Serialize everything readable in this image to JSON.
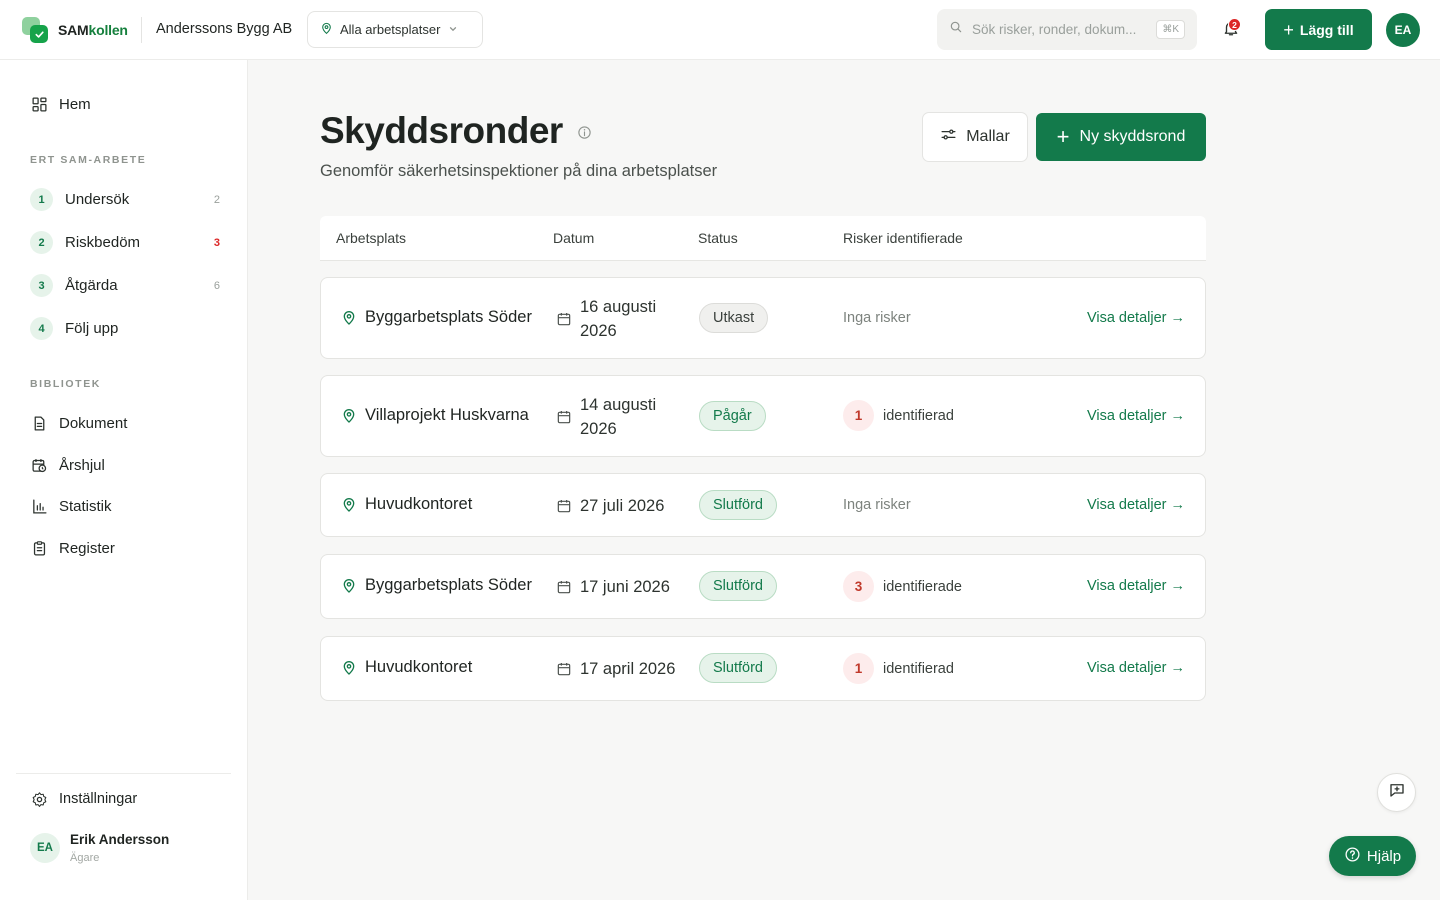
{
  "app": {
    "name_part1": "SAM",
    "name_part2": "kollen"
  },
  "header": {
    "company": "Anderssons Bygg AB",
    "workplace_selector": "Alla arbetsplatser",
    "search_placeholder": "Sök risker, ronder, dokum...",
    "search_shortcut": "⌘K",
    "notification_count": "2",
    "add_button": "Lägg till",
    "avatar_initials": "EA"
  },
  "sidebar": {
    "home": "Hem",
    "section_sam": "ERT SAM-ARBETE",
    "steps": [
      {
        "num": "1",
        "label": "Undersök",
        "count": "2"
      },
      {
        "num": "2",
        "label": "Riskbedöm",
        "count": "3"
      },
      {
        "num": "3",
        "label": "Åtgärda",
        "count": "6"
      },
      {
        "num": "4",
        "label": "Följ upp",
        "count": ""
      }
    ],
    "section_library": "BIBLIOTEK",
    "library": [
      {
        "label": "Dokument"
      },
      {
        "label": "Årshjul"
      },
      {
        "label": "Statistik"
      },
      {
        "label": "Register"
      }
    ],
    "settings": "Inställningar",
    "user": {
      "initials": "EA",
      "name": "Erik Andersson",
      "role": "Ägare"
    }
  },
  "main": {
    "title": "Skyddsronder",
    "subtitle": "Genomför säkerhetsinspektioner på dina arbetsplatser",
    "templates_button": "Mallar",
    "new_button": "Ny skyddsrond",
    "columns": [
      "Arbetsplats",
      "Datum",
      "Status",
      "Risker identifierade"
    ],
    "rows": [
      {
        "place": "Byggarbetsplats Söder",
        "date_line1": "16 augusti",
        "date_line2": "2026",
        "status": "Utkast",
        "risk_count": "",
        "risk_text": "Inga risker",
        "action": "Visa detaljer →"
      },
      {
        "place": "Villaprojekt Huskvarna",
        "date_line1": "14 augusti",
        "date_line2": "2026",
        "status": "Pågår",
        "risk_count": "1",
        "risk_text": "identifierad",
        "action": "Visa detaljer →"
      },
      {
        "place": "Huvudkontoret",
        "date_line1": "27 juli 2026",
        "date_line2": "",
        "status": "Slutförd",
        "risk_count": "",
        "risk_text": "Inga risker",
        "action": "Visa detaljer →"
      },
      {
        "place": "Byggarbetsplats Söder",
        "date_line1": "17 juni 2026",
        "date_line2": "",
        "status": "Slutförd",
        "risk_count": "3",
        "risk_text": "identifierade",
        "action": "Visa detaljer →"
      },
      {
        "place": "Huvudkontoret",
        "date_line1": "17 april 2026",
        "date_line2": "",
        "status": "Slutförd",
        "risk_count": "1",
        "risk_text": "identifierad",
        "action": "Visa detaljer →"
      }
    ]
  },
  "help_button": "Hjälp",
  "colors": {
    "brand": "#137a4b",
    "danger": "#dc2626",
    "background": "#f7f7f6"
  }
}
